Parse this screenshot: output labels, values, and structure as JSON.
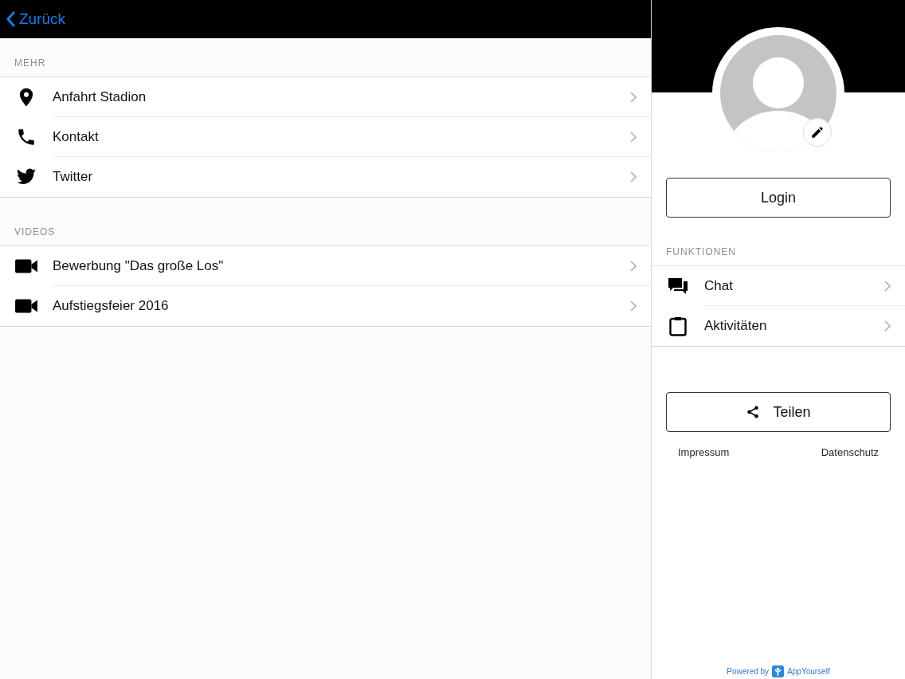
{
  "nav": {
    "back_label": "Zurück"
  },
  "sections": [
    {
      "title": "MEHR",
      "items": [
        {
          "label": "Anfahrt Stadion",
          "kind": "pin"
        },
        {
          "label": "Kontakt",
          "kind": "phone"
        },
        {
          "label": "Twitter",
          "kind": "bird"
        }
      ]
    },
    {
      "title": "VIDEOS",
      "items": [
        {
          "label": "Bewerbung \"Das große Los\"",
          "kind": "video"
        },
        {
          "label": "Aufstiegsfeier 2016",
          "kind": "video"
        }
      ]
    }
  ],
  "sidebar": {
    "login_button": "Login",
    "section_title": "FUNKTIONEN",
    "items": [
      {
        "label": "Chat",
        "kind": "chat"
      },
      {
        "label": "Aktivitäten",
        "kind": "clipboard"
      }
    ],
    "share_button": "Teilen",
    "links": [
      "Impressum",
      "Datenschutz"
    ],
    "powered_by": "Powered by",
    "brand": "AppYourself"
  }
}
